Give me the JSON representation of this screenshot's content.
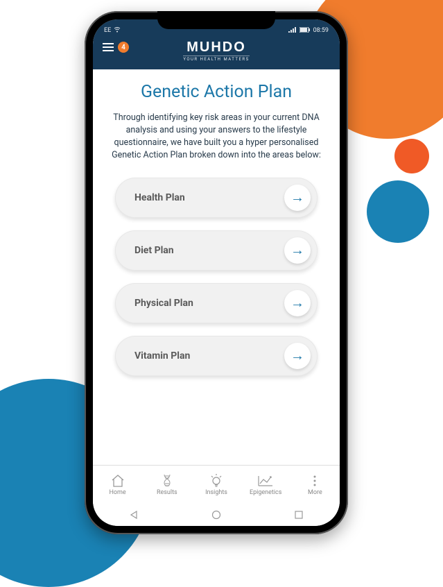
{
  "status_bar": {
    "carrier": "EE",
    "wifi_icon": "wifi",
    "signal_icon": "signal",
    "battery_icon": "battery",
    "time": "08:59"
  },
  "header": {
    "notification_count": "4",
    "logo_main": "MUHDO",
    "logo_subtitle": "YOUR HEALTH MATTERS"
  },
  "page": {
    "title": "Genetic Action Plan",
    "description": "Through identifying key risk areas in your current DNA analysis and using your answers to the lifestyle questionnaire, we have built you a hyper personalised Genetic Action Plan broken down into the areas below:"
  },
  "plans": [
    {
      "label": "Health Plan"
    },
    {
      "label": "Diet Plan"
    },
    {
      "label": "Physical Plan"
    },
    {
      "label": "Vitamin Plan"
    }
  ],
  "bottom_nav": [
    {
      "label": "Home",
      "icon": "home"
    },
    {
      "label": "Results",
      "icon": "dna"
    },
    {
      "label": "Insights",
      "icon": "bulb"
    },
    {
      "label": "Epigenetics",
      "icon": "chart"
    },
    {
      "label": "More",
      "icon": "dots"
    }
  ]
}
